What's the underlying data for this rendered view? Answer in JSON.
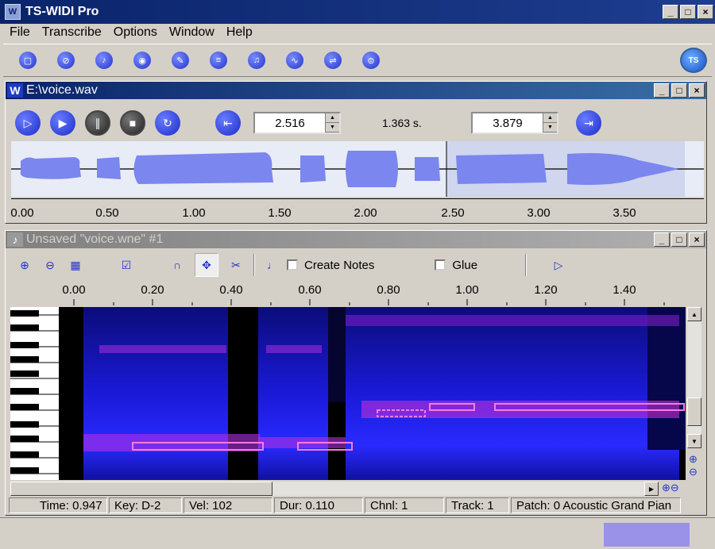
{
  "app": {
    "title": "TS-WIDI Pro",
    "icon": "app-icon"
  },
  "menu": [
    "File",
    "Transcribe",
    "Options",
    "Window",
    "Help"
  ],
  "toolbar_icons": [
    "new-icon",
    "open-icon",
    "record-icon",
    "target-icon",
    "pen-icon",
    "list-icon",
    "midi-icon",
    "wave-icon",
    "tune-icon",
    "settings-icon"
  ],
  "wav_window": {
    "title": "E:\\voice.wav",
    "start_value": "2.516",
    "duration_label": "1.363 s.",
    "end_value": "3.879",
    "axis_ticks": [
      "0.00",
      "0.50",
      "1.00",
      "1.50",
      "2.00",
      "2.50",
      "3.00",
      "3.50"
    ]
  },
  "wne_window": {
    "title": "Unsaved \"voice.wne\" #1",
    "create_notes_label": "Create Notes",
    "glue_label": "Glue",
    "ruler_ticks": [
      "0.00",
      "0.20",
      "0.40",
      "0.60",
      "0.80",
      "1.00",
      "1.20",
      "1.40"
    ],
    "status": {
      "time": "Time: 0.947",
      "key": "Key: D-2",
      "vel": "Vel: 102",
      "dur": "Dur: 0.110",
      "chnl": "Chnl: 1",
      "track": "Track: 1",
      "patch": "Patch: 0 Acoustic Grand Pian"
    }
  },
  "colors": {
    "title_active": "#0a246a",
    "accent_blue": "#2233cc",
    "note_outline": "#ff7adf",
    "status_swatch": "#9a91e8"
  }
}
